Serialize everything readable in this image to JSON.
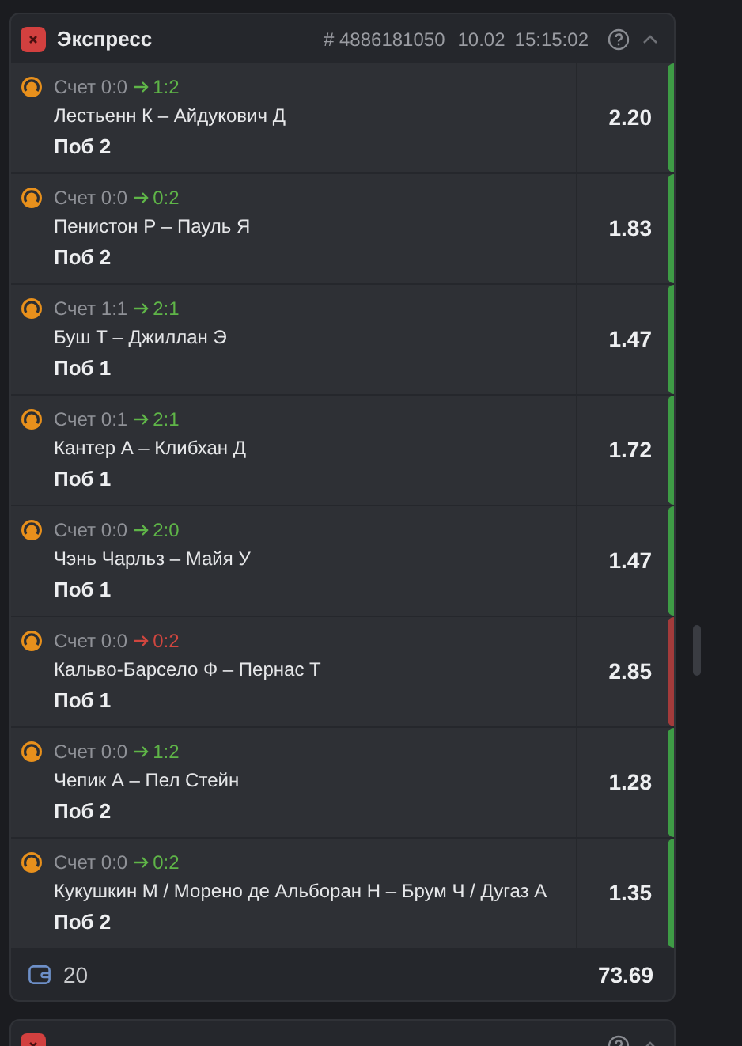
{
  "cards": [
    {
      "title": "Экспресс",
      "bet_id": "# 4886181050",
      "date": "10.02",
      "time": "15:15:02",
      "expanded": true,
      "legs": [
        {
          "score": "Счет 0:0",
          "result": "1:2",
          "match": "Лестьенн К – Айдукович Д",
          "pick": "Поб 2",
          "odds": "2.20",
          "won": true
        },
        {
          "score": "Счет 0:0",
          "result": "0:2",
          "match": "Пенистон Р – Пауль Я",
          "pick": "Поб 2",
          "odds": "1.83",
          "won": true
        },
        {
          "score": "Счет 1:1",
          "result": "2:1",
          "match": "Буш Т – Джиллан Э",
          "pick": "Поб 1",
          "odds": "1.47",
          "won": true
        },
        {
          "score": "Счет 0:1",
          "result": "2:1",
          "match": "Кантер А – Клибхан Д",
          "pick": "Поб 1",
          "odds": "1.72",
          "won": true
        },
        {
          "score": "Счет 0:0",
          "result": "2:0",
          "match": "Чэнь Чарльз – Майя У",
          "pick": "Поб 1",
          "odds": "1.47",
          "won": true
        },
        {
          "score": "Счет 0:0",
          "result": "0:2",
          "match": "Кальво-Барсело Ф – Пернас Т",
          "pick": "Поб 1",
          "odds": "2.85",
          "won": false
        },
        {
          "score": "Счет 0:0",
          "result": "1:2",
          "match": "Чепик А – Пел Стейн",
          "pick": "Поб 2",
          "odds": "1.28",
          "won": true
        },
        {
          "score": "Счет 0:0",
          "result": "0:2",
          "match": "Кукушкин М / Морено де Альборан Н – Брум Ч / Дугаз А",
          "pick": "Поб 2",
          "odds": "1.35",
          "won": true
        }
      ],
      "stake": "20",
      "total_odds": "73.69"
    },
    {
      "expanded": true
    }
  ]
}
